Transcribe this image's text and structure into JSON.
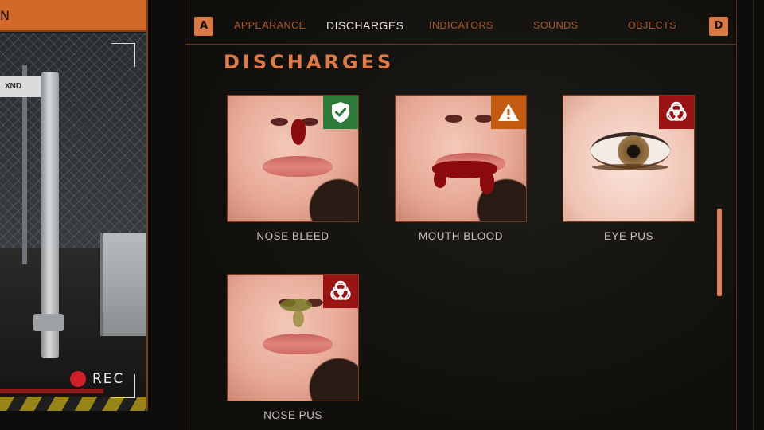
{
  "camera": {
    "title_fragment": "N",
    "sign_text": "XND",
    "rec_label": "REC"
  },
  "tabs": {
    "left_key": "A",
    "right_key": "D",
    "items": [
      {
        "label": "APPEARANCE",
        "active": false
      },
      {
        "label": "DISCHARGES",
        "active": true
      },
      {
        "label": "INDICATORS",
        "active": false
      },
      {
        "label": "SOUNDS",
        "active": false
      },
      {
        "label": "OBJECTS",
        "active": false
      }
    ]
  },
  "section": {
    "title": "DISCHARGES"
  },
  "cards": [
    {
      "label": "NOSE BLEED",
      "badge": "shield-check-icon",
      "badge_color": "#2d7a3a"
    },
    {
      "label": "MOUTH BLOOD",
      "badge": "warning-icon",
      "badge_color": "#c25a12"
    },
    {
      "label": "EYE PUS",
      "badge": "biohazard-icon",
      "badge_color": "#9a1414"
    },
    {
      "label": "NOSE PUS",
      "badge": "biohazard-icon",
      "badge_color": "#9a1414"
    }
  ],
  "colors": {
    "accent": "#e07a45",
    "tab_inactive": "#a8592b",
    "tab_active": "#e6e0d8",
    "panel_border": "#6a3416"
  }
}
